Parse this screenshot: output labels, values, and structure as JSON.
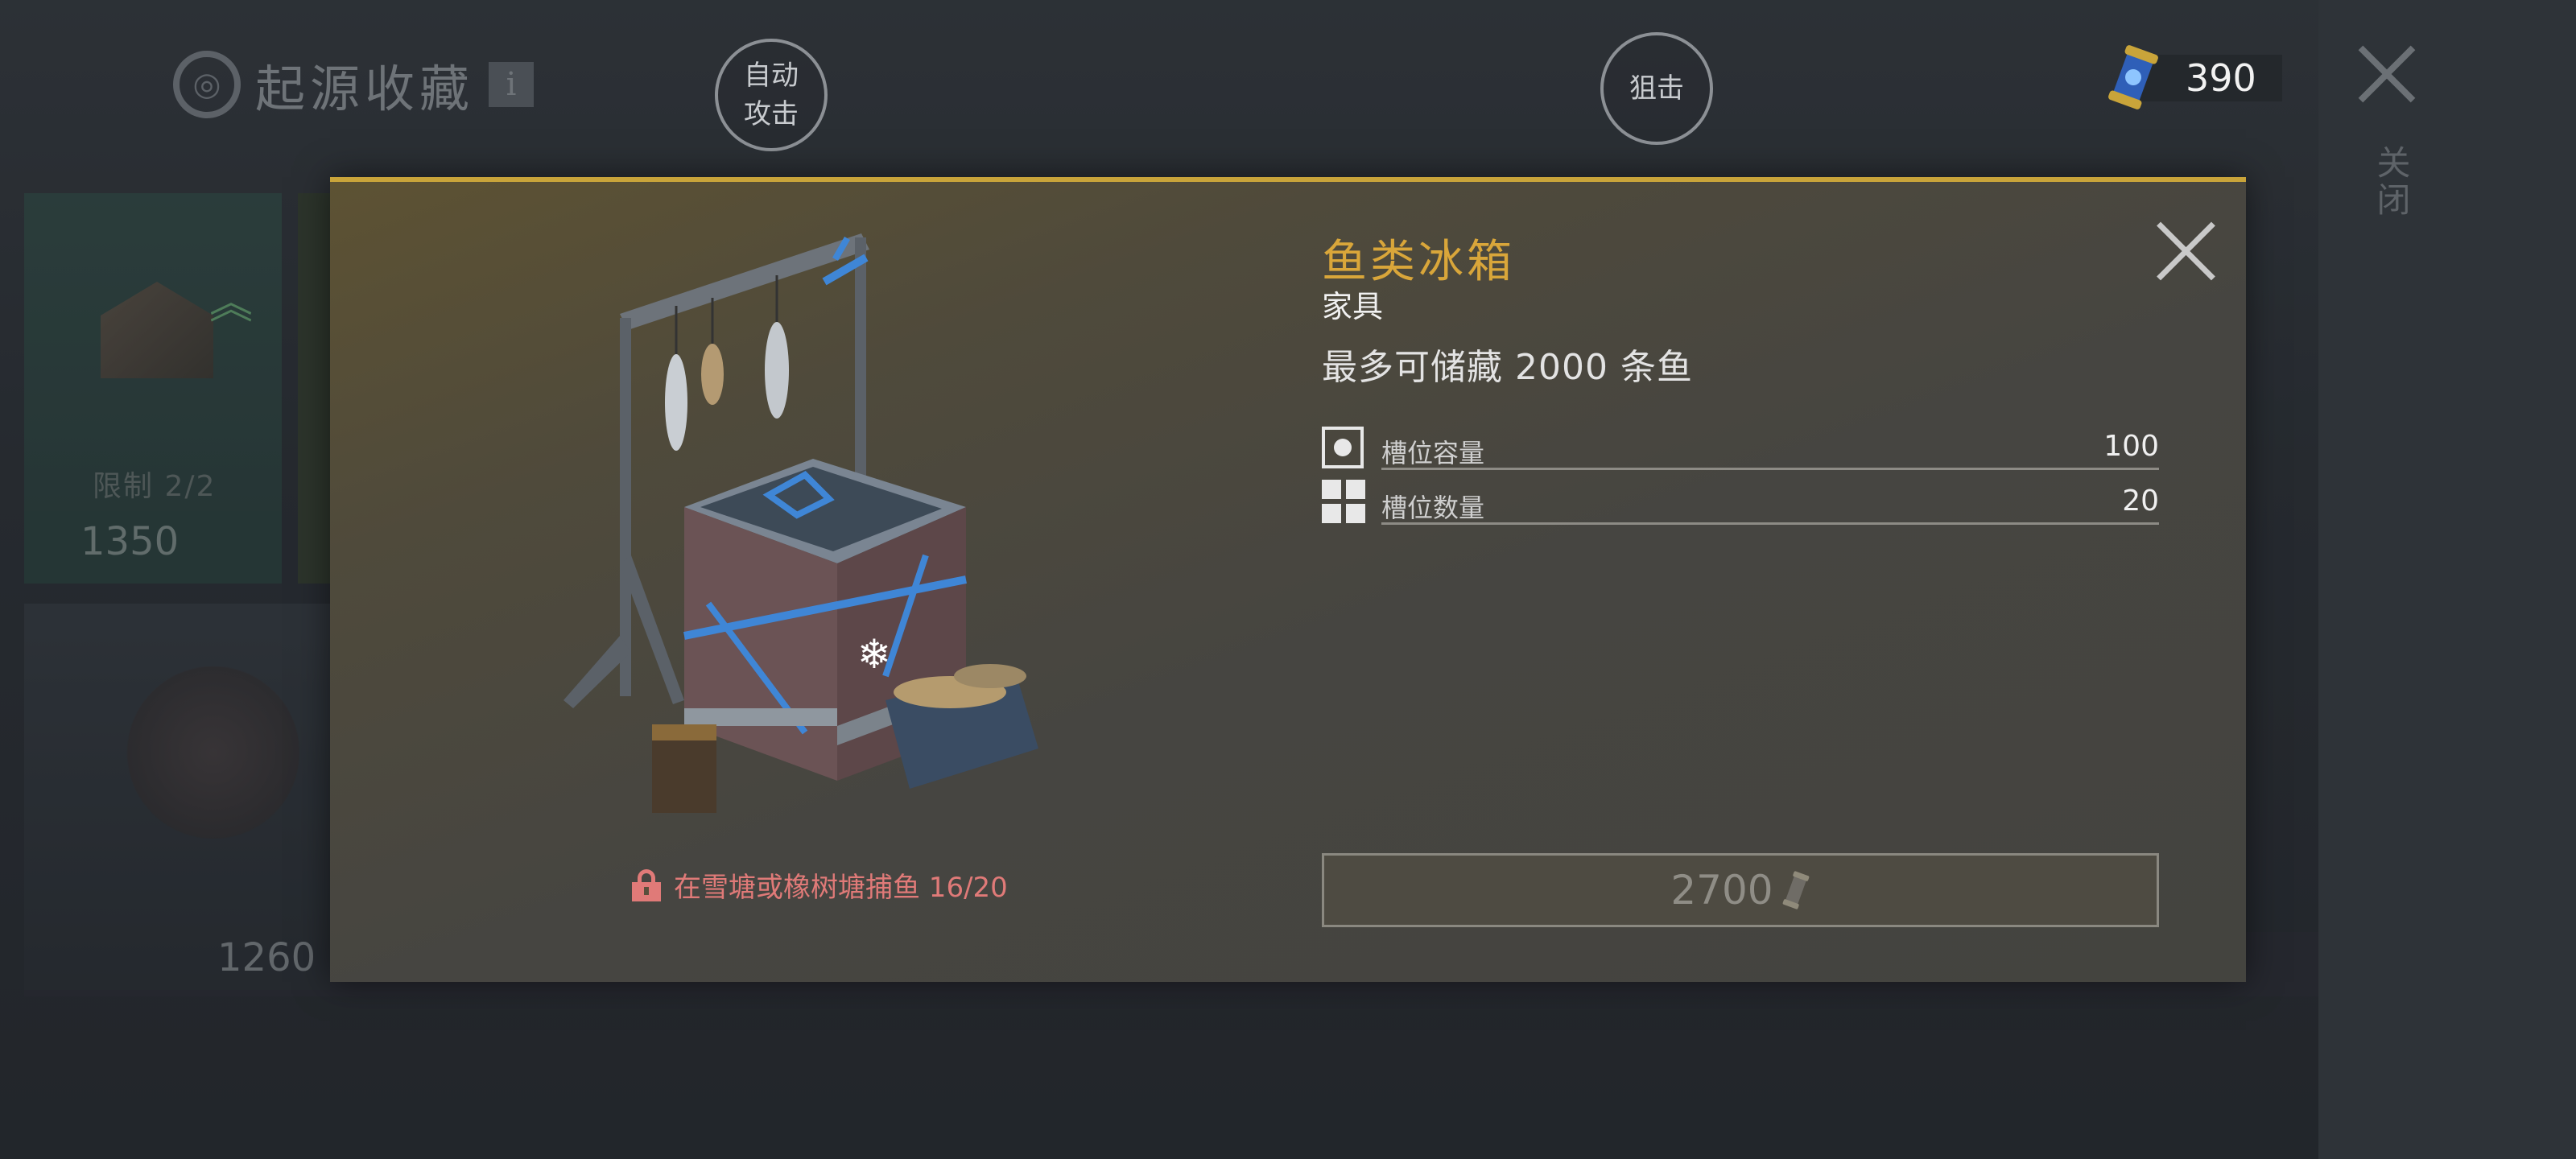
{
  "background": {
    "shop_title": "起源收藏",
    "info_icon": "i",
    "auto_attack_label": "自动\n攻击",
    "snipe_label": "狙击",
    "currency_amount": "390",
    "close_label": "关闭",
    "card1_limit": "限制 2/2",
    "card1_price": "1350",
    "card2_price": "1260"
  },
  "modal": {
    "title": "鱼类冰箱",
    "category": "家具",
    "description": "最多可储藏 2000 条鱼",
    "stats": [
      {
        "label": "槽位容量",
        "value": "100",
        "icon": "slot-capacity-icon"
      },
      {
        "label": "槽位数量",
        "value": "20",
        "icon": "slot-grid-icon"
      }
    ],
    "unlock_requirement": "在雪塘或橡树塘捕鱼 16/20",
    "price": "2700",
    "price_icon": "token-scroll-icon"
  },
  "colors": {
    "accent_gold": "#d9a63a",
    "locked_red": "#e07a78",
    "modal_border": "#c9a43a"
  }
}
